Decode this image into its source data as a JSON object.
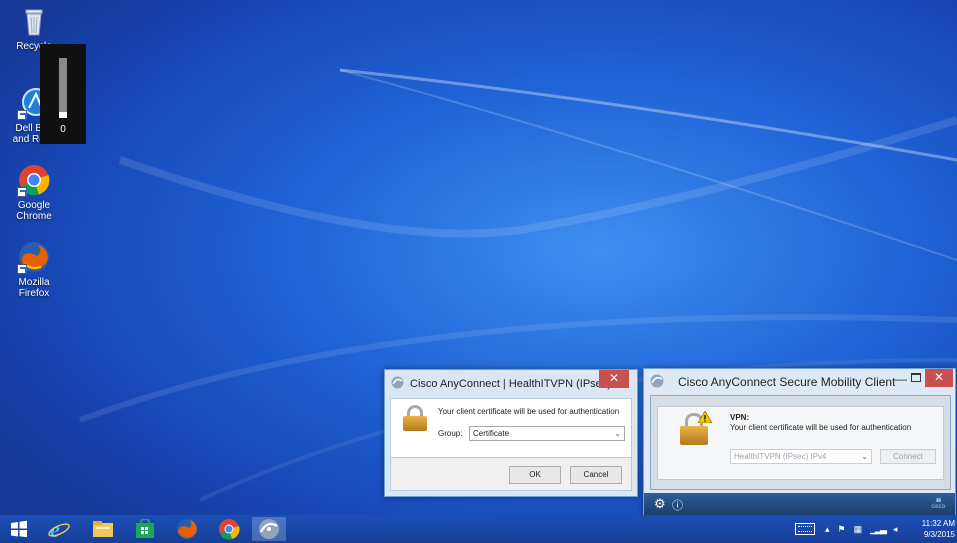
{
  "desktop": {
    "icons": [
      {
        "label": "Recycle",
        "icon": "recycle-bin-icon"
      },
      {
        "label": "Dell Backup and Recovery",
        "label_line1": "Dell Bac",
        "label_line2": "and Reco",
        "icon": "dell-backup-icon"
      },
      {
        "label_line1": "Google",
        "label_line2": "Chrome",
        "icon": "chrome-icon"
      },
      {
        "label_line1": "Mozilla",
        "label_line2": "Firefox",
        "icon": "firefox-icon"
      }
    ]
  },
  "volume": {
    "value": "0",
    "level": 0.1
  },
  "auth_dialog": {
    "title": "Cisco AnyConnect | HealthITVPN (IPsec) I...",
    "message": "Your client certificate will be used for authentication",
    "group_label": "Group:",
    "group_value": "Certificate",
    "ok_label": "OK",
    "cancel_label": "Cancel",
    "close_glyph": "✕"
  },
  "client": {
    "title": "Cisco AnyConnect Secure Mobility Client",
    "vpn_label": "VPN:",
    "message": "Your client certificate will be used for authentication",
    "connection": "HealthITVPN (IPsec) IPv4",
    "connect_label": "Connect",
    "min_glyph": "—",
    "close_glyph": "✕",
    "cisco_text": "cisco"
  },
  "taskbar": {
    "apps": [
      "start-icon",
      "internet-explorer-icon",
      "file-explorer-icon",
      "store-icon",
      "firefox-icon",
      "chrome-icon",
      "anyconnect-icon"
    ],
    "clock_time": "11:32 AM",
    "clock_date": "9/3/2015"
  },
  "colors": {
    "desktop": "#1f63d6",
    "taskbar": "#1b4fb6",
    "close_red": "#c75050",
    "cisco_bar": "#2e5d95"
  }
}
